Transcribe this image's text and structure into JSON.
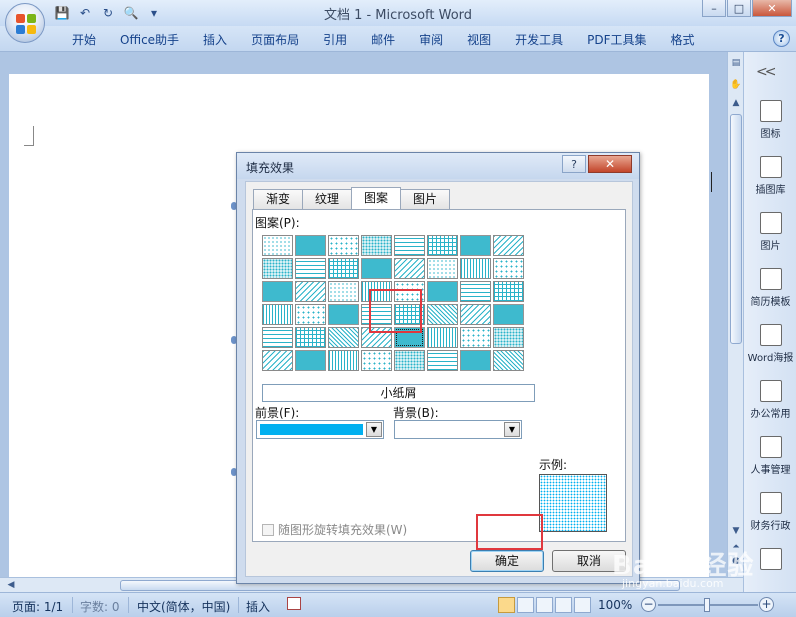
{
  "window": {
    "title": "文档 1 - Microsoft Word",
    "controls": [
      "–",
      "□",
      "✕"
    ]
  },
  "ribbon": {
    "tabs": [
      "开始",
      "Office助手",
      "插入",
      "页面布局",
      "引用",
      "邮件",
      "审阅",
      "视图",
      "开发工具",
      "PDF工具集",
      "格式"
    ]
  },
  "dialog": {
    "title": "填充效果",
    "help": "?",
    "close": "✕",
    "tabs": [
      "渐变",
      "纹理",
      "图案",
      "图片"
    ],
    "active_tab": "图案",
    "pattern_label": "图案(P):",
    "selected_pattern_name": "小纸屑",
    "foreground_label": "前景(F):",
    "background_label": "背景(B):",
    "foreground_color": "#00b0f0",
    "background_color": "#ffffff",
    "sample_label": "示例:",
    "rotate_checkbox": "随图形旋转填充效果(W)",
    "ok_label": "确定",
    "cancel_label": "取消",
    "pattern_rows": 6,
    "pattern_cols": 8,
    "selected_pattern_index": 36,
    "pattern_color": "#2ab3c9"
  },
  "sidepane": {
    "collapse_icon": "double-chevron-left",
    "items": [
      {
        "label": "图标",
        "icon": "shape-icon"
      },
      {
        "label": "插图库",
        "icon": "windmill-icon"
      },
      {
        "label": "图片",
        "icon": "picture-icon"
      },
      {
        "label": "简历模板",
        "icon": "resume-icon"
      },
      {
        "label": "Word海报",
        "icon": "poster-icon"
      },
      {
        "label": "办公常用",
        "icon": "briefcase-icon"
      },
      {
        "label": "人事管理",
        "icon": "hr-icon"
      },
      {
        "label": "财务行政",
        "icon": "finance-icon"
      },
      {
        "label": "",
        "icon": "book-icon"
      }
    ]
  },
  "statusbar": {
    "page": "页面: 1/1",
    "words": "字数: 0",
    "language": "中文(简体，中国)",
    "mode": "插入",
    "zoom": "100%",
    "zoom_minus": "−",
    "zoom_plus": "+"
  },
  "watermark": {
    "text": "Baidu经验",
    "url": "jingyan.baidu.com"
  }
}
